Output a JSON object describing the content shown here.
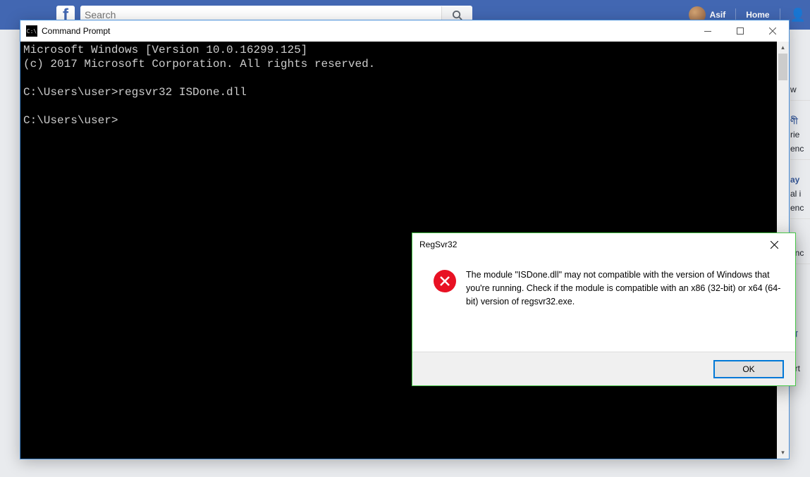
{
  "facebook": {
    "search_placeholder": "Search",
    "username": "Asif",
    "home_label": "Home"
  },
  "right_hints": [
    "w",
    "ণী",
    "rie",
    "enc",
    "ay",
    "al i",
    "enc",
    "e",
    "enc",
    "অ",
    "ert"
  ],
  "cmd": {
    "title": "Command Prompt",
    "lines": "Microsoft Windows [Version 10.0.16299.125]\n(c) 2017 Microsoft Corporation. All rights reserved.\n\nC:\\Users\\user>regsvr32 ISDone.dll\n\nC:\\Users\\user>"
  },
  "dialog": {
    "title": "RegSvr32",
    "message": "The module \"ISDone.dll\" may not compatible with the version of Windows that you're running. Check if the module is compatible with an x86 (32-bit) or x64 (64-bit) version of regsvr32.exe.",
    "ok_label": "OK"
  }
}
